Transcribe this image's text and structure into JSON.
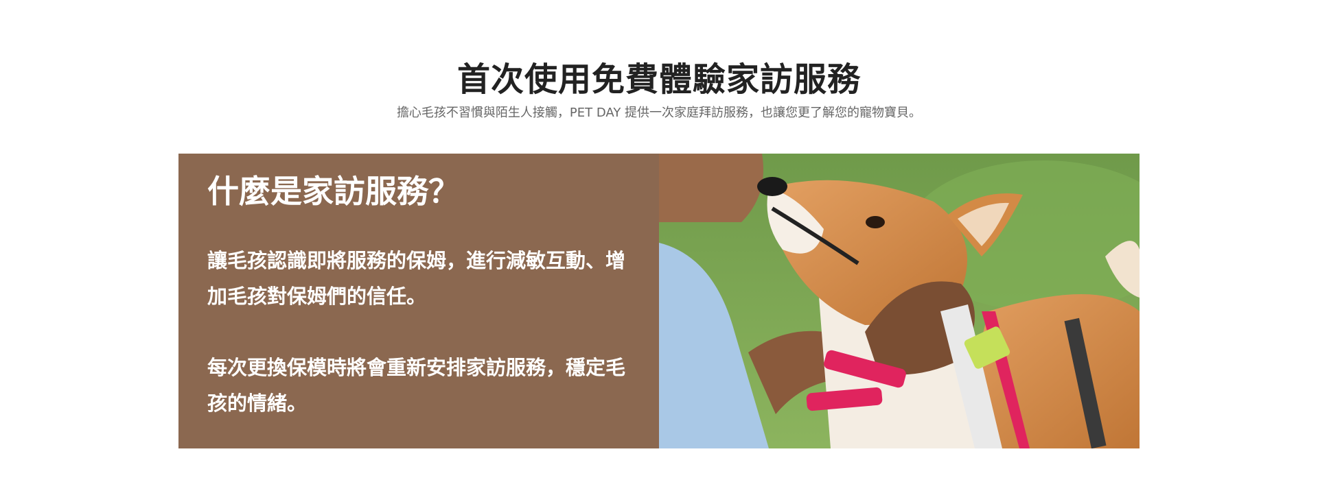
{
  "header": {
    "title": "首次使用免費體驗家訪服務",
    "subtitle": "擔心毛孩不習慣與陌生人接觸，PET DAY 提供一次家庭拜訪服務，也讓您更了解您的寵物寶貝。"
  },
  "card": {
    "title": "什麼是家訪服務？",
    "paragraphs": [
      "讓毛孩認識即將服務的保姆，進行減敏互動、增加毛孩對保姆們的信任。",
      "每次更換保模時將會重新安排家訪服務，穩定毛孩的情緒。"
    ],
    "image_icon": "shiba-dog-photo",
    "colors": {
      "card_bg": "#8b6850",
      "title_text": "#222222",
      "subtitle_text": "#666666",
      "grass": "#6f9a4a",
      "dog_fur": "#d48a45",
      "leash": "#e0245e",
      "tag": "#c5e05a"
    }
  }
}
